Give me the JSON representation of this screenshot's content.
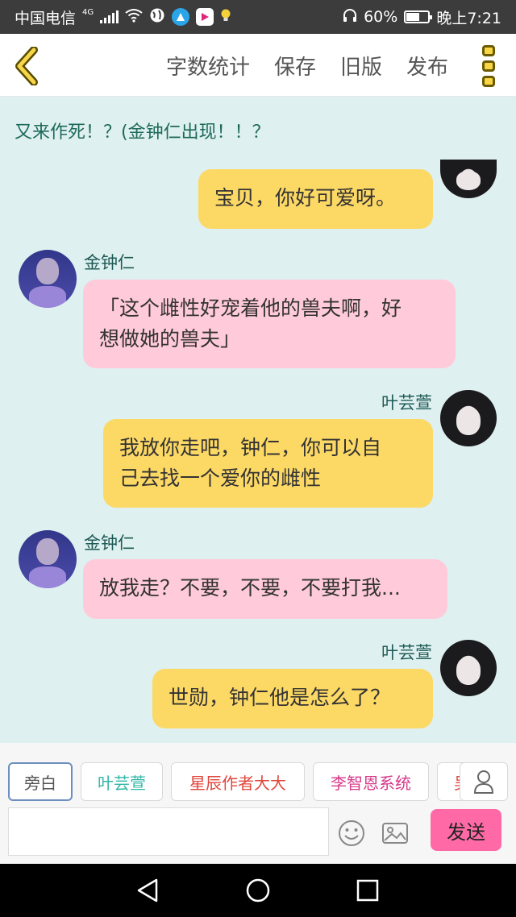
{
  "status": {
    "carrier": "中国电信",
    "network": "4G",
    "battery": "60%",
    "battery_level": 0.6,
    "time": "晚上7:21"
  },
  "toolbar": {
    "word_count": "字数统计",
    "save": "保存",
    "old_version": "旧版",
    "publish": "发布"
  },
  "chat": {
    "narration": "又来作死！？(金钟仁出现！！？",
    "messages": [
      {
        "side": "right",
        "name": "",
        "text": "宝贝，你好可爱呀。"
      },
      {
        "side": "left",
        "name": "金钟仁",
        "line1": "「这个雌性好宠着他的兽夫啊，好",
        "line2": "想做她的兽夫」"
      },
      {
        "side": "right",
        "name": "叶芸萱",
        "line1": "我放你走吧，钟仁，你可以自",
        "line2": "己去找一个爱你的雌性"
      },
      {
        "side": "left",
        "name": "金钟仁",
        "text": "放我走？不要，不要，不要打我..."
      },
      {
        "side": "right",
        "name": "叶芸萱",
        "text": "世勋，钟仁他是怎么了？"
      }
    ]
  },
  "roles": [
    {
      "label": "旁白",
      "color": "#555555"
    },
    {
      "label": "叶芸萱",
      "color": "#2fb5a6"
    },
    {
      "label": "星辰作者大大",
      "color": "#e0463c"
    },
    {
      "label": "李智恩系统",
      "color": "#d63a8a"
    },
    {
      "label": "吴",
      "color": "#e0463c"
    }
  ],
  "composer": {
    "input_value": "",
    "send": "发送"
  },
  "icons": {
    "back": "chevron-left-icon",
    "more": "more-vertical-icon",
    "user": "user-icon",
    "emoji": "emoji-icon",
    "image": "image-icon",
    "nav_back": "triangle-back-icon",
    "nav_home": "circle-home-icon",
    "nav_recent": "square-recent-icon"
  },
  "colors": {
    "chat_bg": "#dff0f0",
    "my_bubble": "#fcd865",
    "other_bubble": "#ffcad9",
    "send_button": "#ff6aa6",
    "name_text": "#1d5a55"
  }
}
